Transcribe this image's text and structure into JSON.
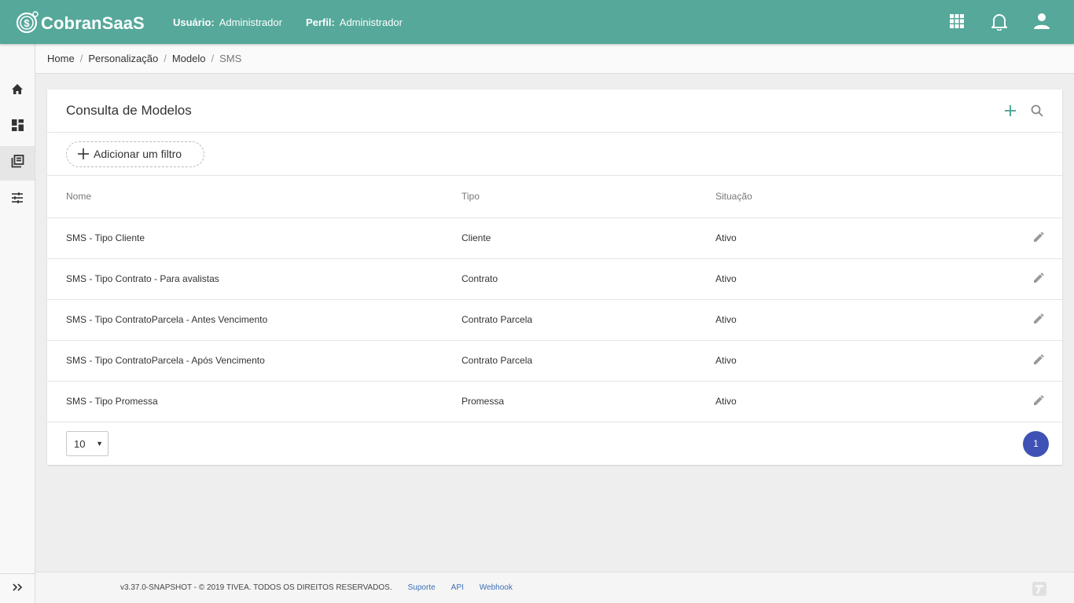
{
  "app": {
    "name": "CobranSaaS",
    "accent_color": "#55a89a",
    "user_label": "Usuário:",
    "user_value": "Administrador",
    "profile_label": "Perfil:",
    "profile_value": "Administrador"
  },
  "topbar_icons": [
    "apps-grid-icon",
    "bell-icon",
    "user-icon"
  ],
  "sidebar": {
    "items": [
      {
        "name": "home-icon",
        "active": false
      },
      {
        "name": "dashboard-icon",
        "active": false
      },
      {
        "name": "library-books-icon",
        "active": true
      },
      {
        "name": "tune-icon",
        "active": false
      }
    ],
    "expand_icon": "double-chevron-right-icon"
  },
  "breadcrumb": [
    {
      "label": "Home"
    },
    {
      "label": "Personalização"
    },
    {
      "label": "Modelo"
    },
    {
      "label": "SMS"
    }
  ],
  "card": {
    "title": "Consulta de Modelos",
    "add_filter_label": "Adicionar um filtro"
  },
  "table": {
    "headers": {
      "nome": "Nome",
      "tipo": "Tipo",
      "situacao": "Situação"
    },
    "rows": [
      {
        "nome": "SMS - Tipo Cliente",
        "tipo": "Cliente",
        "situacao": "Ativo"
      },
      {
        "nome": "SMS - Tipo Contrato - Para avalistas",
        "tipo": "Contrato",
        "situacao": "Ativo"
      },
      {
        "nome": "SMS - Tipo ContratoParcela - Antes Vencimento",
        "tipo": "Contrato Parcela",
        "situacao": "Ativo"
      },
      {
        "nome": "SMS - Tipo ContratoParcela - Após Vencimento",
        "tipo": "Contrato Parcela",
        "situacao": "Ativo"
      },
      {
        "nome": "SMS - Tipo Promessa",
        "tipo": "Promessa",
        "situacao": "Ativo"
      }
    ]
  },
  "pagination": {
    "page_size": "10",
    "current_page": "1",
    "page_color": "#3f51b5"
  },
  "footer": {
    "copyright": "v3.37.0-SNAPSHOT - © 2019 TIVEA. TODOS OS DIREITOS RESERVADOS.",
    "links": [
      "Suporte",
      "API",
      "Webhook"
    ]
  }
}
